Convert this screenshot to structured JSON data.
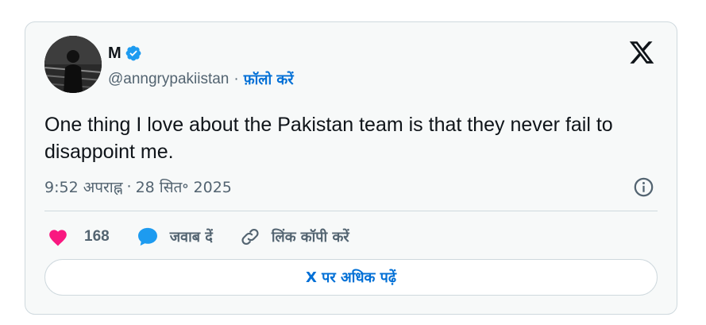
{
  "tweet": {
    "author": {
      "name": "M",
      "handle": "@anngrypakiistan",
      "verified": true
    },
    "separator": "·",
    "follow_label": "फ़ॉलो करें",
    "text": "One thing I love about the Pakistan team is that they never fail to disappoint me.",
    "time": "9:52 अपराह्न",
    "date": "28 सित॰ 2025",
    "likes": "168",
    "reply_label": "जवाब दें",
    "copy_link_label": "लिंक कॉपी करें",
    "read_more_label": "X पर अधिक पढ़ें"
  },
  "icons": {
    "platform_logo": "x-logo-icon",
    "verified": "verified-badge-icon",
    "info": "info-icon",
    "like": "heart-icon",
    "reply": "speech-bubble-icon",
    "copy_link": "link-icon"
  },
  "colors": {
    "card_background": "#f7f9f9",
    "border": "#cfd9de",
    "text_primary": "#0f1419",
    "text_secondary": "#536471",
    "link_blue": "#006fd6",
    "verified_blue": "#1d9bf0",
    "like_pink": "#f91880"
  }
}
